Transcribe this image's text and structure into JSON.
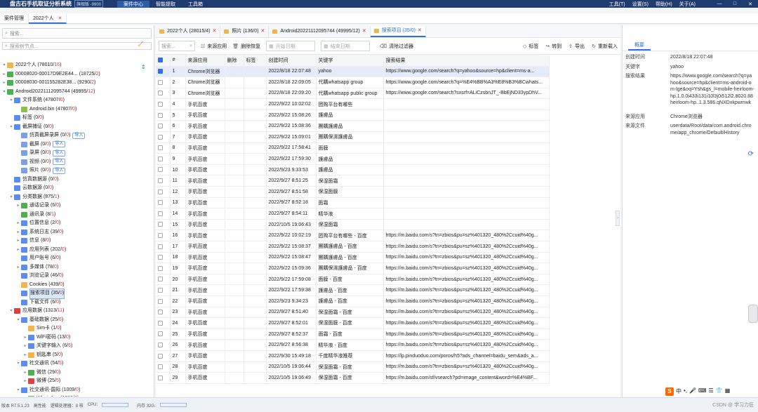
{
  "app": {
    "title": "盘古石手机取证分析系统",
    "edition": "旗舰版 -9900",
    "menus": [
      "案件中心",
      "智能提取",
      "工具箱"
    ],
    "right_menus": [
      "工具(T)",
      "设置(S)",
      "帮助(H)",
      "关于(A)"
    ],
    "window_controls": [
      "—",
      "□",
      "✕"
    ]
  },
  "case_tabs": [
    "案件管理",
    "2022个人"
  ],
  "sidebar": {
    "search_placeholder": "搜索...",
    "search2_placeholder": "搜索树节点...",
    "tree": [
      {
        "indent": 0,
        "tw": "▾",
        "color": "#f0b54c",
        "label": "2022个人",
        "count": "78010",
        "sub": "16"
      },
      {
        "indent": 0,
        "tw": "▸",
        "color": "#4caf50",
        "label": "00008020-00017D9E2E44...",
        "count": "18725",
        "sub": "2"
      },
      {
        "indent": 0,
        "tw": "▸",
        "color": "#4caf50",
        "label": "00008030-001155282E38...",
        "count": "9290",
        "sub": "2"
      },
      {
        "indent": 0,
        "tw": "▾",
        "color": "#4caf50",
        "label": "Android20221112095744",
        "count": "49995",
        "sub": "12"
      },
      {
        "indent": 1,
        "tw": "▾",
        "color": "#5b8def",
        "label": "文件系统",
        "count": "47807",
        "sub": "0"
      },
      {
        "indent": 2,
        "tw": "",
        "color": "#8bc34a",
        "label": "Android.bin",
        "count": "47807",
        "sub": "0"
      },
      {
        "indent": 1,
        "tw": "",
        "color": "#5b8def",
        "label": "标签",
        "count": "0",
        "sub": "0"
      },
      {
        "indent": 1,
        "tw": "▾",
        "color": "#5b8def",
        "label": "截屏捕证",
        "count": "0",
        "sub": "0"
      },
      {
        "indent": 2,
        "tw": "",
        "color": "#7aa0e8",
        "label": "仿真截屏录屏",
        "count": "0",
        "sub": "0",
        "import": "导入"
      },
      {
        "indent": 2,
        "tw": "",
        "color": "#7aa0e8",
        "label": "截屏",
        "count": "0",
        "sub": "0",
        "import": "导入"
      },
      {
        "indent": 2,
        "tw": "",
        "color": "#7aa0e8",
        "label": "录屏",
        "count": "0",
        "sub": "0",
        "import": "导入"
      },
      {
        "indent": 2,
        "tw": "",
        "color": "#7aa0e8",
        "label": "视频",
        "count": "0",
        "sub": "0",
        "import": "导入"
      },
      {
        "indent": 2,
        "tw": "",
        "color": "#7aa0e8",
        "label": "照片",
        "count": "0",
        "sub": "0",
        "import": "导入"
      },
      {
        "indent": 1,
        "tw": "",
        "color": "#5b8def",
        "label": "仿真数据源",
        "count": "0",
        "sub": "0"
      },
      {
        "indent": 1,
        "tw": "",
        "color": "#5b8def",
        "label": "云数据源",
        "count": "0",
        "sub": "0"
      },
      {
        "indent": 1,
        "tw": "▾",
        "color": "#5b8def",
        "label": "分类数据",
        "count": "875",
        "sub": "1"
      },
      {
        "indent": 2,
        "tw": "▸",
        "color": "#4caf50",
        "label": "通话记录",
        "count": "6",
        "sub": "0"
      },
      {
        "indent": 2,
        "tw": "",
        "color": "#4caf50",
        "label": "通讯录",
        "count": "8",
        "sub": "1"
      },
      {
        "indent": 2,
        "tw": "▸",
        "color": "#5b8def",
        "label": "位置信息",
        "count": "2",
        "sub": "0"
      },
      {
        "indent": 2,
        "tw": "▸",
        "color": "#5b8def",
        "label": "系统日志",
        "count": "39",
        "sub": "0"
      },
      {
        "indent": 2,
        "tw": "▸",
        "color": "#5b8def",
        "label": "信息",
        "count": "8",
        "sub": "0"
      },
      {
        "indent": 2,
        "tw": "▸",
        "color": "#5b8def",
        "label": "应用列表",
        "count": "202",
        "sub": "0"
      },
      {
        "indent": 2,
        "tw": "",
        "color": "#5b8def",
        "label": "用户账号",
        "count": "6",
        "sub": "0"
      },
      {
        "indent": 2,
        "tw": "▸",
        "color": "#5b8def",
        "label": "多媒体",
        "count": "78",
        "sub": "0"
      },
      {
        "indent": 2,
        "tw": "",
        "color": "#5b8def",
        "label": "浏览记录",
        "count": "46",
        "sub": "0"
      },
      {
        "indent": 2,
        "tw": "",
        "color": "#f0b54c",
        "label": "Cookies",
        "count": "439",
        "sub": "0"
      },
      {
        "indent": 2,
        "tw": "",
        "color": "#5b8def",
        "label": "搜索项目",
        "count": "35",
        "sub": "0",
        "selected": true
      },
      {
        "indent": 2,
        "tw": "",
        "color": "#5b8def",
        "label": "下载文件",
        "count": "6",
        "sub": "0"
      },
      {
        "indent": 1,
        "tw": "▾",
        "color": "#e04040",
        "label": "应用数据",
        "count": "1313",
        "sub": "11"
      },
      {
        "indent": 2,
        "tw": "▾",
        "color": "#5b8def",
        "label": "基础数据",
        "count": "25",
        "sub": "6"
      },
      {
        "indent": 3,
        "tw": "",
        "color": "#f0b54c",
        "label": "Sim卡",
        "count": "1",
        "sub": "0"
      },
      {
        "indent": 3,
        "tw": "▸",
        "color": "#5b8def",
        "label": "WiFi密码",
        "count": "13",
        "sub": "0"
      },
      {
        "indent": 3,
        "tw": "▸",
        "color": "#5b8def",
        "label": "关键字输入",
        "count": "6",
        "sub": "6"
      },
      {
        "indent": 3,
        "tw": "▸",
        "color": "#f0b54c",
        "label": "钥匙串",
        "count": "5",
        "sub": "0"
      },
      {
        "indent": 2,
        "tw": "▾",
        "color": "#5b8def",
        "label": "社交通讯",
        "count": "54",
        "sub": "5"
      },
      {
        "indent": 3,
        "tw": "▸",
        "color": "#4caf50",
        "label": "微信",
        "count": "29",
        "sub": "0"
      },
      {
        "indent": 3,
        "tw": "▸",
        "color": "#e04040",
        "label": "微博",
        "count": "25",
        "sub": "5"
      },
      {
        "indent": 2,
        "tw": "▾",
        "color": "#5b8def",
        "label": "社交通讯-国际",
        "count": "1009",
        "sub": "0"
      },
      {
        "indent": 3,
        "tw": "▸",
        "color": "#4caf50",
        "label": "WhatsApp",
        "count": "1009",
        "sub": "0"
      }
    ]
  },
  "subtabs": [
    {
      "label": "2022个人",
      "count": "28015",
      "sub": "4"
    },
    {
      "label": "照片",
      "count": "136",
      "sub": "0"
    },
    {
      "label": "Android20221112095744",
      "count": "49995",
      "sub": "12"
    },
    {
      "label": "搜索项目",
      "count": "35",
      "sub": "0",
      "active": true
    }
  ],
  "toolbar": {
    "search_placeholder": "搜索...",
    "source_app": "来源应用",
    "delete_restore": "删除恢复",
    "start_date": "开始日期",
    "end_date": "结束日期",
    "clear_filter": "清除过滤器",
    "tag": "标签",
    "goto": "转到",
    "export": "导出",
    "reimport": "重新载入"
  },
  "table": {
    "headers": [
      "#",
      "来源应用",
      "删除",
      "标签",
      "创建时间",
      "关键字",
      "搜索结果"
    ],
    "rows": [
      [
        "1",
        "Chrome浏览器",
        "",
        "",
        "2022/8/18 22:07:48",
        "yahoo",
        "https://www.google.com/search?q=yahoo&source=hp&client=ms-a..."
      ],
      [
        "2",
        "Chrome浏览器",
        "",
        "",
        "2022/8/18 22:09:05",
        "代購whatsapp group",
        "https://www.google.com/search?q=%E4%BB%A3%E8%B3%BCwhats..."
      ],
      [
        "3",
        "Chrome浏览器",
        "",
        "",
        "2022/8/18 22:09:20",
        "代購whatsapp public group",
        "https://www.google.com/search?sxsrf=ALiCzsbnJT_-BbEjND33ypDhV..."
      ],
      [
        "4",
        "手机百度",
        "",
        "",
        "2022/9/22 10:02:02",
        "团购平台有哪些",
        ""
      ],
      [
        "5",
        "手机百度",
        "",
        "",
        "2022/9/22 15:08:26",
        "護膚品",
        ""
      ],
      [
        "6",
        "手机百度",
        "",
        "",
        "2022/9/22 15:08:36",
        "團購護膚品",
        ""
      ],
      [
        "7",
        "手机百度",
        "",
        "",
        "2022/9/22 15:09:01",
        "團購保濕護膚品",
        ""
      ],
      [
        "8",
        "手机百度",
        "",
        "",
        "2022/9/22 17:58:41",
        "面膜",
        ""
      ],
      [
        "9",
        "手机百度",
        "",
        "",
        "2022/9/22 17:59:30",
        "護膚品",
        ""
      ],
      [
        "10",
        "手机百度",
        "",
        "",
        "2022/9/23 9:33:53",
        "護膚品",
        ""
      ],
      [
        "11",
        "手机百度",
        "",
        "",
        "2022/9/27 8:51:25",
        "保湿面霜",
        ""
      ],
      [
        "12",
        "手机百度",
        "",
        "",
        "2022/9/27 8:51:58",
        "保湿面膜",
        ""
      ],
      [
        "13",
        "手机百度",
        "",
        "",
        "2022/9/27 8:52:18",
        "面霜",
        ""
      ],
      [
        "14",
        "手机百度",
        "",
        "",
        "2022/9/27 8:54:11",
        "精华液",
        ""
      ],
      [
        "15",
        "手机百度",
        "",
        "",
        "2022/10/5 19:06:43",
        "保湿面霜",
        ""
      ],
      [
        "16",
        "手机百度",
        "",
        "",
        "2022/9/22 10:02:19",
        "团购平台有哪些 - 百度",
        "https://m.baidu.com/s?tn=zbios&pu=sz%401320_480%2Ccuid%40g..."
      ],
      [
        "17",
        "手机百度",
        "",
        "",
        "2022/9/22 15:08:37",
        "團購護膚品 - 百度",
        "https://m.baidu.com/s?tn=zbios&pu=sz%401320_480%2Ccuid%40g..."
      ],
      [
        "18",
        "手机百度",
        "",
        "",
        "2022/9/22 15:08:47",
        "團購護膚品 - 百度",
        "https://m.baidu.com/s?tn=zbios&pu=sz%401320_480%2Ccuid%40g..."
      ],
      [
        "19",
        "手机百度",
        "",
        "",
        "2022/9/22 15:09:36",
        "團購保濕護膚品 - 百度",
        "https://m.baidu.com/s?tn=zbios&pu=sz%401320_480%2Ccuid%40g..."
      ],
      [
        "20",
        "手机百度",
        "",
        "",
        "2022/9/22 17:59:08",
        "面膜 - 百度",
        "https://m.baidu.com/s?tn=zbios&pu=sz%401320_480%2Ccuid%40g..."
      ],
      [
        "21",
        "手机百度",
        "",
        "",
        "2022/9/22 17:59:38",
        "護膚品 - 百度",
        "https://m.baidu.com/s?tn=zbios&pu=sz%401320_480%2Ccuid%40g..."
      ],
      [
        "22",
        "手机百度",
        "",
        "",
        "2022/9/23 9:34:23",
        "護膚品 - 百度",
        "https://m.baidu.com/s?tn=zbios&pu=sz%401320_480%2Ccuid%40g..."
      ],
      [
        "23",
        "手机百度",
        "",
        "",
        "2022/9/27 8:51:40",
        "保湿面霜 - 百度",
        "https://m.baidu.com/s?tn=zbios&pu=sz%401320_480%2Ccuid%40g..."
      ],
      [
        "24",
        "手机百度",
        "",
        "",
        "2022/9/27 8:52:01",
        "保湿面膜 - 百度",
        "https://m.baidu.com/s?tn=zbios&pu=sz%401320_480%2Ccuid%40g..."
      ],
      [
        "25",
        "手机百度",
        "",
        "",
        "2022/9/27 8:52:37",
        "面霜 - 百度",
        "https://m.baidu.com/s?tn=zbios&pu=sz%401320_480%2Ccuid%40g..."
      ],
      [
        "26",
        "手机百度",
        "",
        "",
        "2022/9/27 8:56:38",
        "精华液 - 百度",
        "https://m.baidu.com/s?tn=zbios&pu=sz%401320_480%2Ccuid%40g..."
      ],
      [
        "27",
        "手机百度",
        "",
        "",
        "2022/9/30 15:49:18",
        "千度精华液推荐",
        "https://lp.pinduoduo.com/poros/h5?ads_channel=baidu_sem&ads_a..."
      ],
      [
        "28",
        "手机百度",
        "",
        "",
        "2022/10/5 19:06:44",
        "保湿面霜 - 百度",
        "https://m.baidu.com/s?tn=zbios&pu=sz%401320_480%2Ccuid%40g..."
      ],
      [
        "29",
        "手机百度",
        "",
        "",
        "2022/10/5 19:06:49",
        "保湿面霜 - 百度",
        "https://m.baidu.com/sf/vsearch?pd=image_content&word=%E4%BF..."
      ]
    ]
  },
  "detail": {
    "tab": "概要",
    "fields": [
      {
        "k": "创建时间",
        "v": "2022/8/18 22:07:48"
      },
      {
        "k": "关键字",
        "v": "yahoo"
      },
      {
        "k": "搜索结果",
        "v": "https://www.google.com/search?q=yahoo&source=hp&client=ms-android-om-lge&oq=Ysh&gs_l=mobile-heirloom-hp.1.0.0i433i131i10l3j0i512l2.8020.88heirloom-hp..1.3.586.qNXDxkpwmwk"
      },
      {
        "k": "来源应用",
        "v": "Chrome浏览器"
      },
      {
        "k": "来源文件",
        "v": "userdata/Root/data/com.android.chrome/app_chrome/Default/History"
      }
    ]
  },
  "status": {
    "version": "版本 R7.5.1.23",
    "db": "高性能",
    "threads": "逻辑处理器：8 核",
    "cpu": "CPU:",
    "mem": "内存 32G:",
    "watermark": "CSDN @ 学习力狂"
  },
  "ime": {
    "brand": "S",
    "items": [
      "中",
      "•,",
      "🎤",
      "⌨",
      "☰",
      "👕",
      "▦"
    ]
  }
}
